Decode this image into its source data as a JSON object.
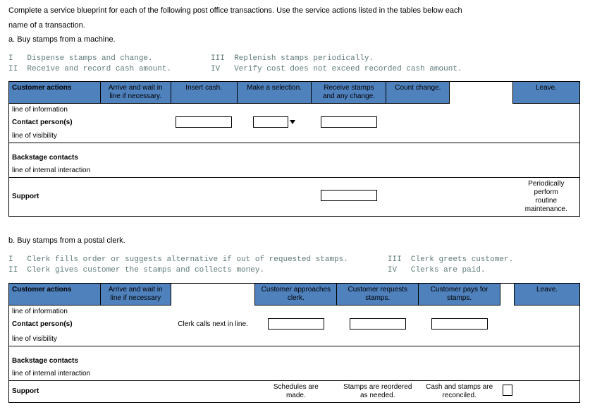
{
  "intro": {
    "line1": "Complete a service blueprint for each of the following post office transactions. Use the service actions listed in the tables below each",
    "line2": "name of a transaction."
  },
  "partA": {
    "label": "a. Buy stamps from a machine.",
    "roman": {
      "i": "Dispense stamps and change.",
      "ii": "Receive and record cash amount.",
      "iii": "Replenish stamps periodically.",
      "iv": "Verify cost does not exceed recorded cash amount."
    },
    "rows": {
      "customer": "Customer actions",
      "lineInfo": "line of information",
      "contact": "Contact person(s)",
      "lineVis": "line of visibility",
      "backstage": "Backstage contacts",
      "lineInt": "line of internal interaction",
      "support": "Support"
    },
    "cust": {
      "c1": "Arrive and wait in\nline if necessary.",
      "c2": "Insert cash.",
      "c3": "Make a selection.",
      "c4": "Receive stamps\nand any change.",
      "c5": "Count change.",
      "c6": "Leave."
    },
    "supportNote": "Periodically perform\nroutine maintenance."
  },
  "partB": {
    "label": "b. Buy stamps from a postal clerk.",
    "roman": {
      "i": "Clerk fills order or suggests alternative if out of requested stamps.",
      "ii": "Clerk gives customer the stamps and collects money.",
      "iii": "Clerk greets customer.",
      "iv": "Clerks are paid."
    },
    "rows": {
      "customer": "Customer actions",
      "lineInfo": "line of information",
      "contact": "Contact person(s)",
      "lineVis": "line of visibility",
      "backstage": "Backstage contacts",
      "lineInt": "line of internal interaction",
      "support": "Support"
    },
    "cust": {
      "c1": "Arrive and wait in\nline if necessary",
      "c3": "Customer approaches\nclerk.",
      "c4": "Customer requests\nstamps.",
      "c5": "Customer pays for\nstamps.",
      "c6": "Leave."
    },
    "contactNote": "Clerk calls next in line.",
    "support": {
      "s3": "Schedules are\nmade.",
      "s4": "Stamps are reordered\nas needed.",
      "s5": "Cash and stamps are\nreconciled."
    }
  }
}
